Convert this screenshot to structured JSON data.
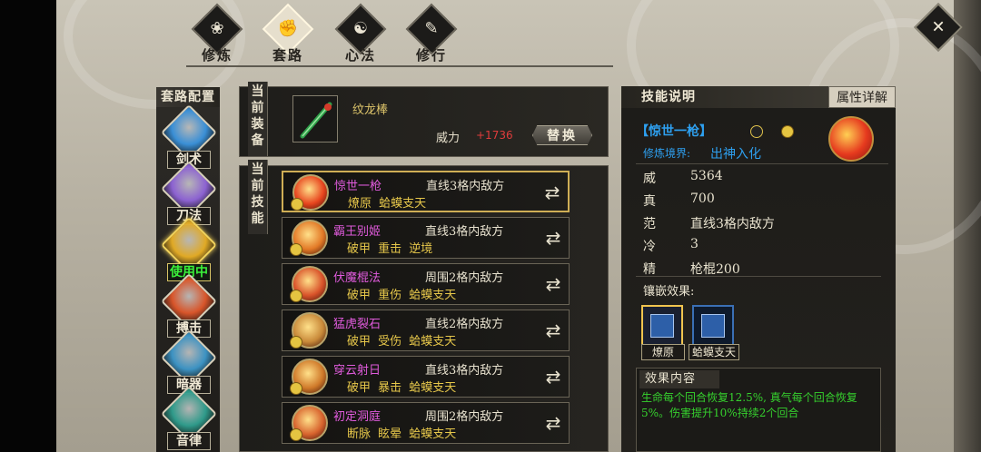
{
  "nav": {
    "tabs": [
      {
        "label": "修炼",
        "glyph": "❀"
      },
      {
        "label": "套路",
        "glyph": "✊"
      },
      {
        "label": "心法",
        "glyph": "☯"
      },
      {
        "label": "修行",
        "glyph": "✎"
      }
    ],
    "active": "套路",
    "close_icon": "✕"
  },
  "sidebar": {
    "title": "套路配置",
    "items": [
      {
        "label": "剑术",
        "color": "#3a8fd6",
        "state": "normal"
      },
      {
        "label": "刀法",
        "color": "#8c62d1",
        "state": "normal"
      },
      {
        "label": "使用中",
        "color": "#e0a925",
        "state": "active"
      },
      {
        "label": "搏击",
        "color": "#d8552a",
        "state": "normal"
      },
      {
        "label": "暗器",
        "color": "#3c92c2",
        "state": "normal"
      },
      {
        "label": "音律",
        "color": "#2f9a8a",
        "state": "normal"
      }
    ]
  },
  "equipment": {
    "tag": [
      "当",
      "前",
      "装",
      "备"
    ],
    "weapon_name": "纹龙棒",
    "power_label": "威力",
    "power_value": "+1736",
    "replace_label": "替换"
  },
  "skills": {
    "tag": [
      "当",
      "前",
      "技",
      "能"
    ],
    "rows": [
      {
        "name": "惊世一枪",
        "range": "直线3格内敌方",
        "tags": "燎原 蛤蟆支天",
        "color": "#e8451e",
        "selected": true
      },
      {
        "name": "霸王别姬",
        "range": "直线3格内敌方",
        "tags": "破甲 重击 逆境",
        "color": "#e37a27",
        "selected": false
      },
      {
        "name": "伏魔棍法",
        "range": "周围2格内敌方",
        "tags": "破甲 重伤 蛤蟆支天",
        "color": "#d9532a",
        "selected": false
      },
      {
        "name": "猛虎裂石",
        "range": "直线2格内敌方",
        "tags": "破甲 受伤 蛤蟆支天",
        "color": "#c98a3a",
        "selected": false
      },
      {
        "name": "穿云射日",
        "range": "直线3格内敌方",
        "tags": "破甲 暴击 蛤蟆支天",
        "color": "#d07a2a",
        "selected": false
      },
      {
        "name": "初定洞庭",
        "range": "周围2格内敌方",
        "tags": "断脉 眩晕 蛤蟆支天",
        "color": "#d8642e",
        "selected": false
      }
    ],
    "swap_icon": "⇄"
  },
  "info": {
    "tab_skill": "技能说明",
    "tab_attr": "属性详解",
    "skill_title": "【惊世一枪】",
    "realm_label": "修炼境界:",
    "realm_value": "出神入化",
    "stats": [
      {
        "k": "威",
        "v": "5364"
      },
      {
        "k": "真",
        "v": "700"
      },
      {
        "k": "范",
        "v": "直线3格内敌方"
      },
      {
        "k": "冷",
        "v": "3"
      },
      {
        "k": "精",
        "v": "枪棍200"
      }
    ],
    "inlay_label": "镶嵌效果:",
    "gems": [
      {
        "label": "燎原",
        "selected": true
      },
      {
        "label": "蛤蟆支天",
        "selected": false
      }
    ],
    "effect_title": "效果内容",
    "effect_text": "生命每个回合恢复12.5%, 真气每个回合恢复5%。伤害提升10%持续2个回合"
  }
}
